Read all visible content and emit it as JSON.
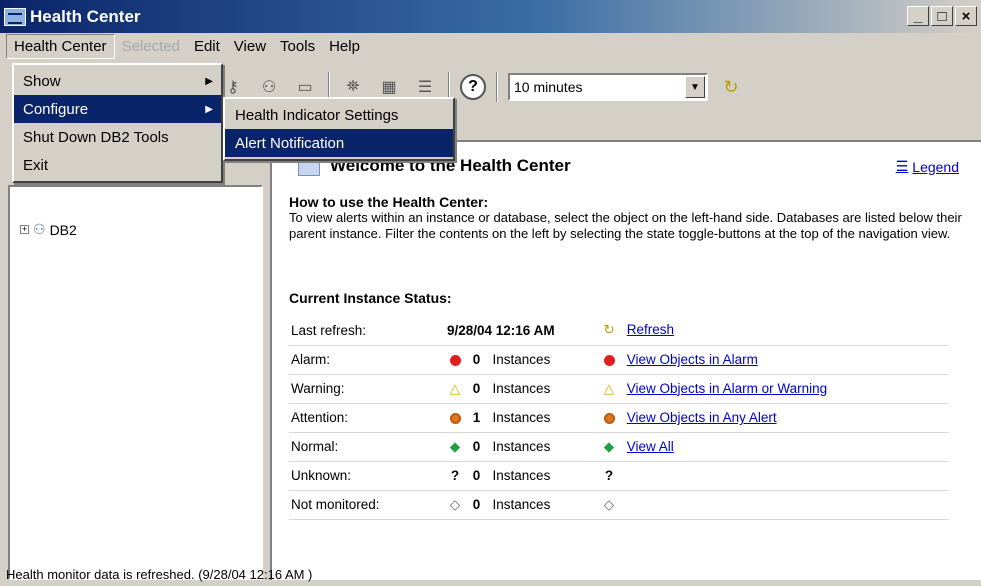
{
  "window": {
    "title": "Health Center",
    "min": "_",
    "max": "□",
    "close": "×"
  },
  "menubar": [
    "Health Center",
    "Selected",
    "Edit",
    "View",
    "Tools",
    "Help"
  ],
  "dropdown": [
    {
      "label": "Show"
    },
    {
      "label": "Configure"
    },
    {
      "label": "Shut Down DB2 Tools"
    },
    {
      "label": "Exit"
    }
  ],
  "submenu": [
    {
      "label": "Health Indicator Settings"
    },
    {
      "label": "Alert Notification"
    }
  ],
  "toolbar": {
    "interval": "10 minutes",
    "help": "?"
  },
  "tree": {
    "root": "DB2"
  },
  "welcome": {
    "title": "Welcome to the Health Center",
    "legend": "Legend"
  },
  "howto": {
    "heading": "How to use the Health Center:",
    "text": "To view alerts within an instance or database, select the object on the left-hand side. Databases are listed below their parent instance. Filter the contents on the left by selecting the state toggle-buttons at the top of the navigation view."
  },
  "status": {
    "heading": "Current Instance Status:",
    "last_refresh_label": "Last refresh:",
    "last_refresh_value": "9/28/04 12:16 AM",
    "refresh_link": "Refresh",
    "rows": [
      {
        "label": "Alarm:",
        "count": "0",
        "unit": "Instances",
        "link": "View Objects in Alarm",
        "color": "#e02020"
      },
      {
        "label": "Warning:",
        "count": "0",
        "unit": "Instances",
        "link": "View Objects in Alarm or Warning",
        "color": "#c8b400"
      },
      {
        "label": "Attention:",
        "count": "1",
        "unit": "Instances",
        "link": "View Objects in Any Alert",
        "color": "#e07820"
      },
      {
        "label": "Normal:",
        "count": "0",
        "unit": "Instances",
        "link": "View All",
        "color": "#20a040"
      },
      {
        "label": "Unknown:",
        "count": "0",
        "unit": "Instances",
        "link": "",
        "color": "#000000"
      },
      {
        "label": "Not monitored:",
        "count": "0",
        "unit": "Instances",
        "link": "",
        "color": "#666666"
      }
    ]
  },
  "statusbar": "Health monitor data is refreshed. (9/28/04 12:16 AM )"
}
